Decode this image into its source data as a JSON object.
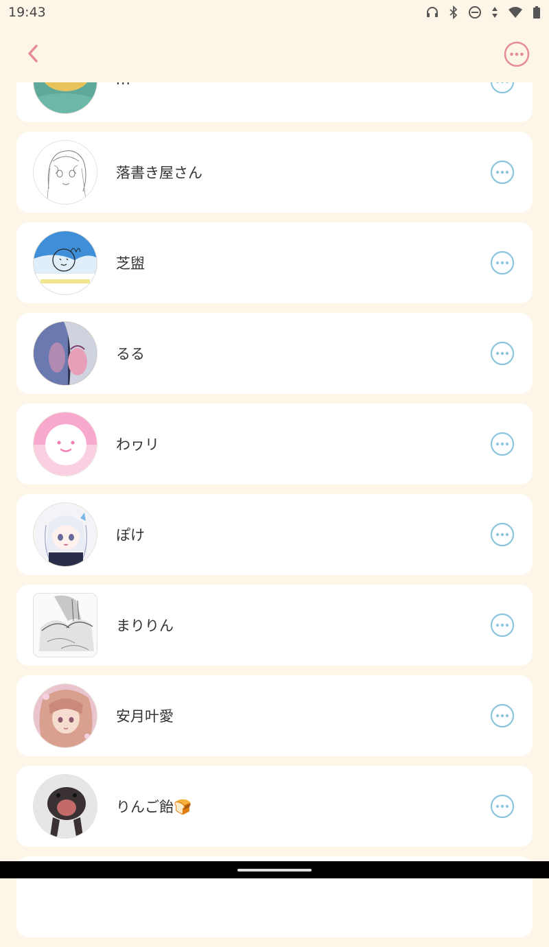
{
  "status_bar": {
    "time": "19:43",
    "icons": [
      "headphones-icon",
      "bluetooth-icon",
      "do-not-disturb-icon",
      "data-arrows-icon",
      "wifi-icon",
      "battery-icon"
    ]
  },
  "header": {
    "back_icon": "chevron-left-icon",
    "more_icon": "more-horizontal-circle-icon",
    "accent_color": "#e58a96"
  },
  "list": {
    "row_more_color": "#8cc4e0",
    "items": [
      {
        "name": "m",
        "avatar": "avatar-teal-yellow"
      },
      {
        "name": "落書き屋さん",
        "avatar": "avatar-line-drawing"
      },
      {
        "name": "芝盥",
        "avatar": "avatar-sky-doodle"
      },
      {
        "name": "るる",
        "avatar": "avatar-dark-illustration"
      },
      {
        "name": "わヮリ",
        "avatar": "avatar-pink-face"
      },
      {
        "name": "ぽけ",
        "avatar": "avatar-chibi-girl"
      },
      {
        "name": "まりりん",
        "avatar": "avatar-sketch-hands"
      },
      {
        "name": "安月叶愛",
        "avatar": "avatar-pink-anime-girl"
      },
      {
        "name": "りんご飴🍞",
        "avatar": "avatar-dark-animal"
      }
    ]
  }
}
